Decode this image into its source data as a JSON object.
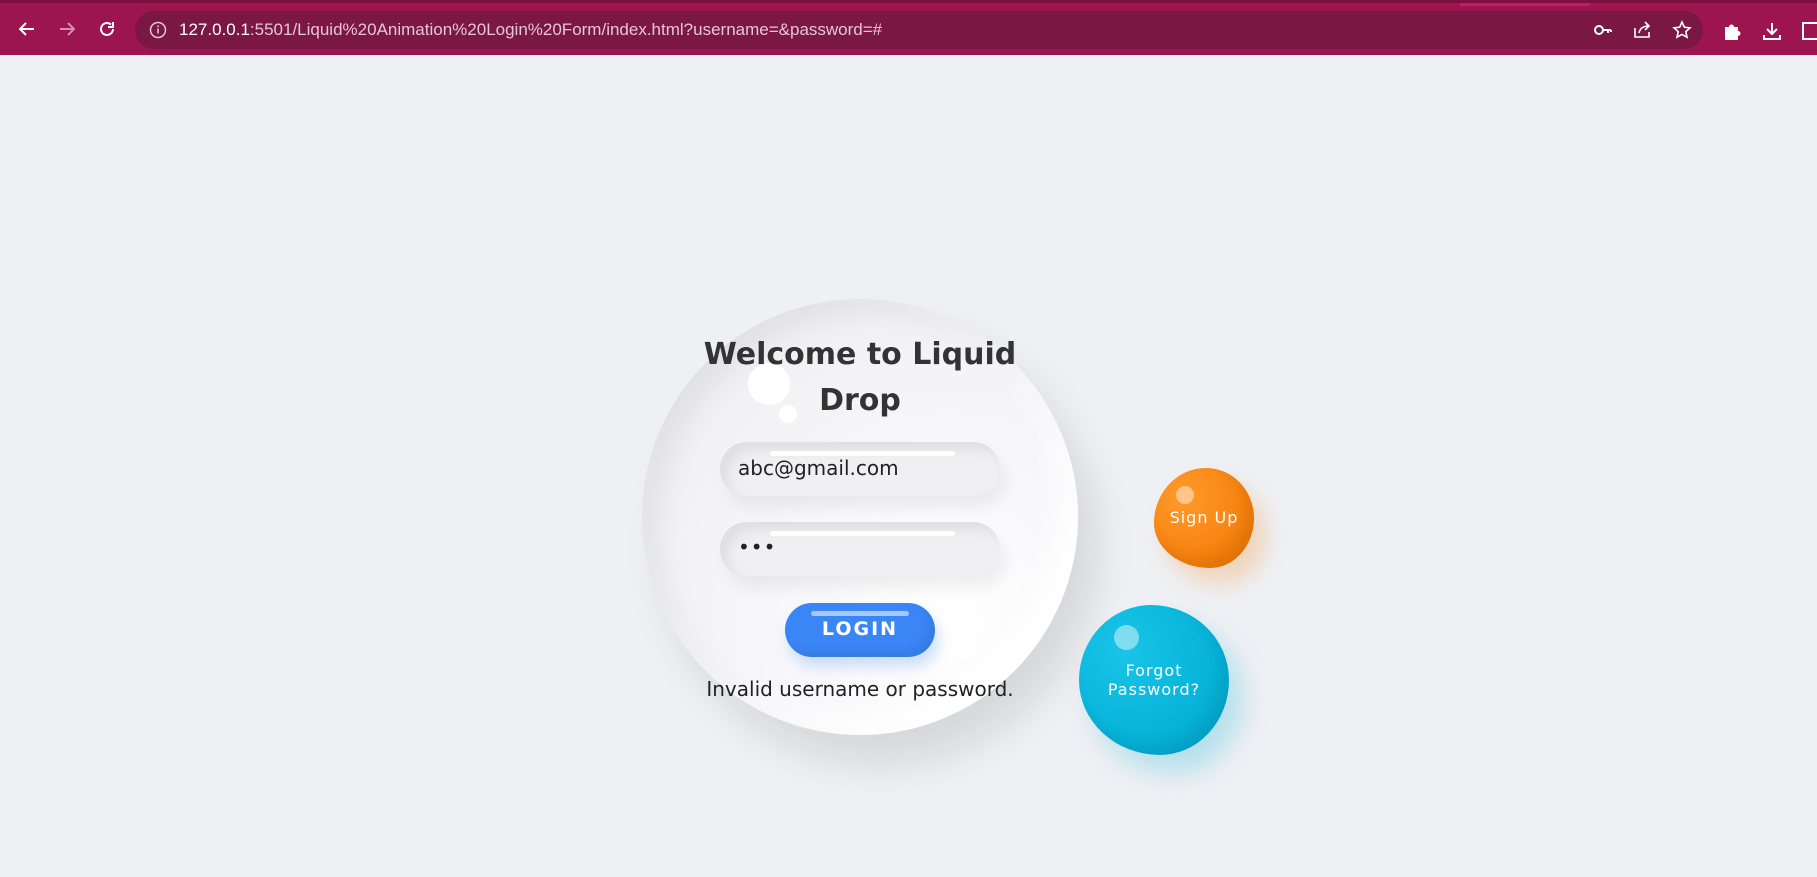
{
  "browser": {
    "url_host": "127.0.0.1",
    "url_rest": ":5501/Liquid%20Animation%20Login%20Form/index.html?username=&password=#",
    "icons": {
      "back": "arrow-left-icon",
      "forward": "arrow-right-icon",
      "reload": "reload-icon",
      "info": "info-icon",
      "password": "key-icon",
      "share": "share-icon",
      "bookmark": "star-icon",
      "extensions": "puzzle-icon",
      "downloads": "download-icon",
      "window": "window-icon"
    },
    "theme_color": "#9c1550"
  },
  "login_form": {
    "title": "Welcome to Liquid Drop",
    "username_value": "abc@gmail.com",
    "password_mask": "•••",
    "login_label": "LOGIN",
    "error_message": "Invalid username or password.",
    "button_color": "#3b86f7"
  },
  "actions": {
    "signup_label": "Sign Up",
    "signup_color": "#f7830f",
    "forgot_line1": "Forgot",
    "forgot_line2": "Password?",
    "forgot_color": "#07b3d9"
  }
}
